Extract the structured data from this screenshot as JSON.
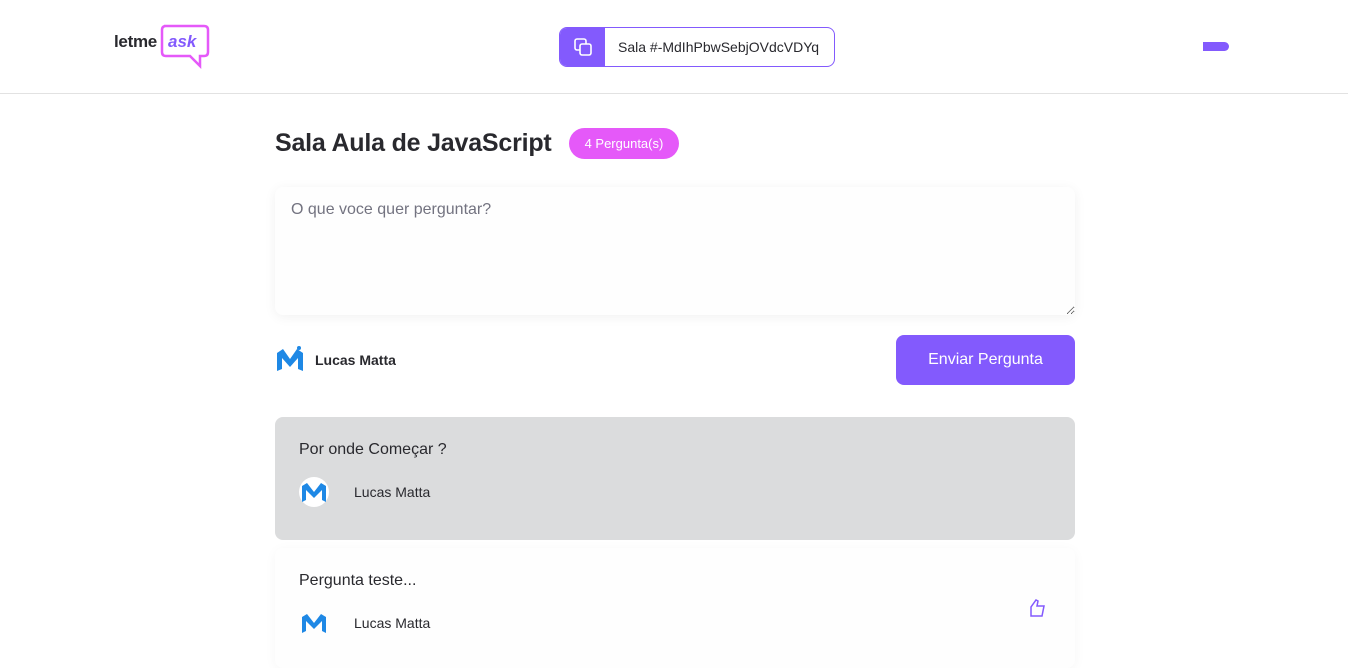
{
  "header": {
    "logo_text": "letme",
    "logo_accent": "ask",
    "room_code": "Sala #-MdIhPbwSebjOVdcVDYq",
    "copy_icon": "copy-icon"
  },
  "room": {
    "title": "Sala Aula de JavaScript",
    "question_count": "4 Pergunta(s)"
  },
  "form": {
    "placeholder": "O que voce quer perguntar?",
    "user_name": "Lucas Matta",
    "submit_label": "Enviar Pergunta"
  },
  "questions": [
    {
      "content": "Por onde Começar ?",
      "author": "Lucas Matta",
      "highlighted": true
    },
    {
      "content": "Pergunta teste...",
      "author": "Lucas Matta",
      "highlighted": false
    }
  ],
  "colors": {
    "accent": "#835afd",
    "badge": "#e559f9",
    "highlight_bg": "#dbdcdd",
    "avatar_blue": "#1e88e5"
  }
}
